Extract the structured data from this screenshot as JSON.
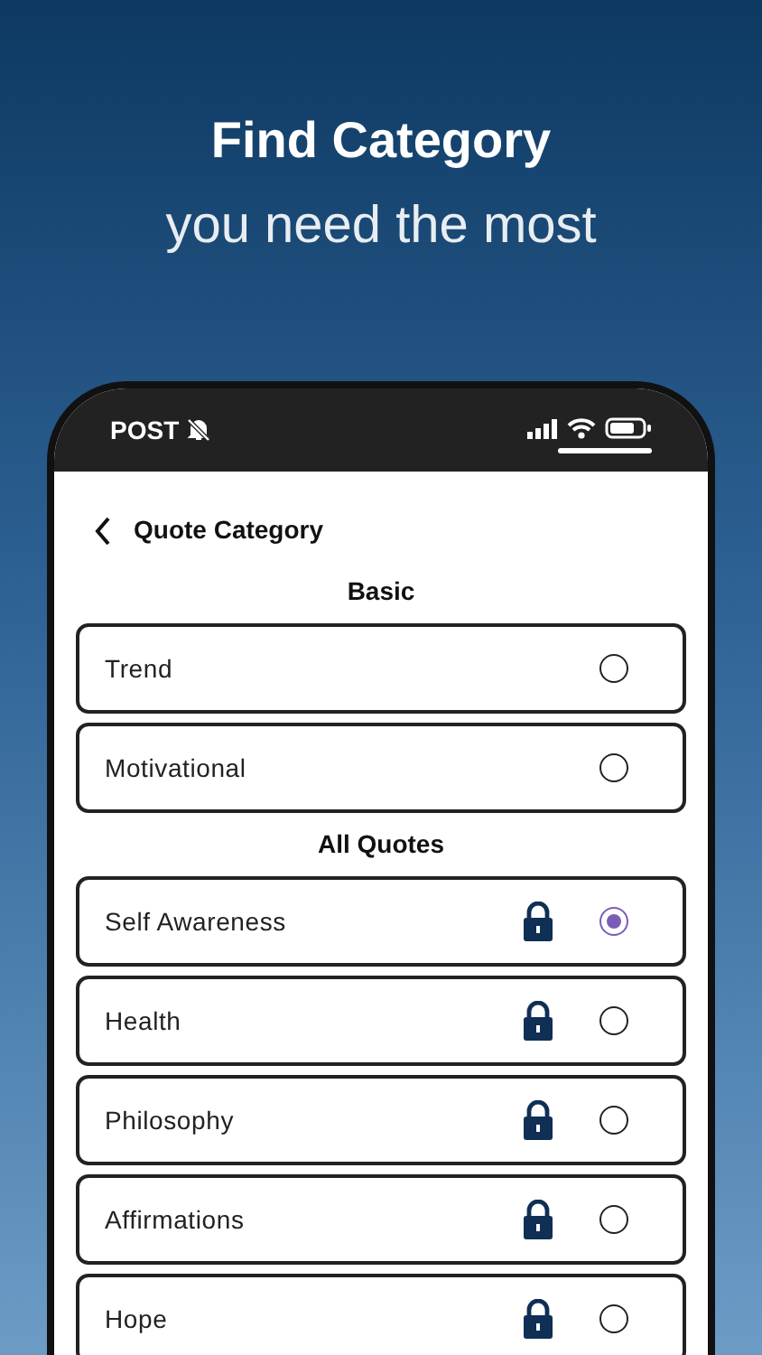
{
  "headline": "Find Category",
  "subheadline": "you need the most",
  "status_bar": {
    "carrier": "POST",
    "muted": true
  },
  "header": {
    "title": "Quote Category"
  },
  "sections": [
    {
      "title": "Basic",
      "items": [
        {
          "label": "Trend",
          "locked": false,
          "selected": false
        },
        {
          "label": "Motivational",
          "locked": false,
          "selected": false
        }
      ]
    },
    {
      "title": "All Quotes",
      "items": [
        {
          "label": "Self Awareness",
          "locked": true,
          "selected": true
        },
        {
          "label": "Health",
          "locked": true,
          "selected": false
        },
        {
          "label": "Philosophy",
          "locked": true,
          "selected": false
        },
        {
          "label": "Affirmations",
          "locked": true,
          "selected": false
        },
        {
          "label": "Hope",
          "locked": true,
          "selected": false
        }
      ]
    }
  ]
}
